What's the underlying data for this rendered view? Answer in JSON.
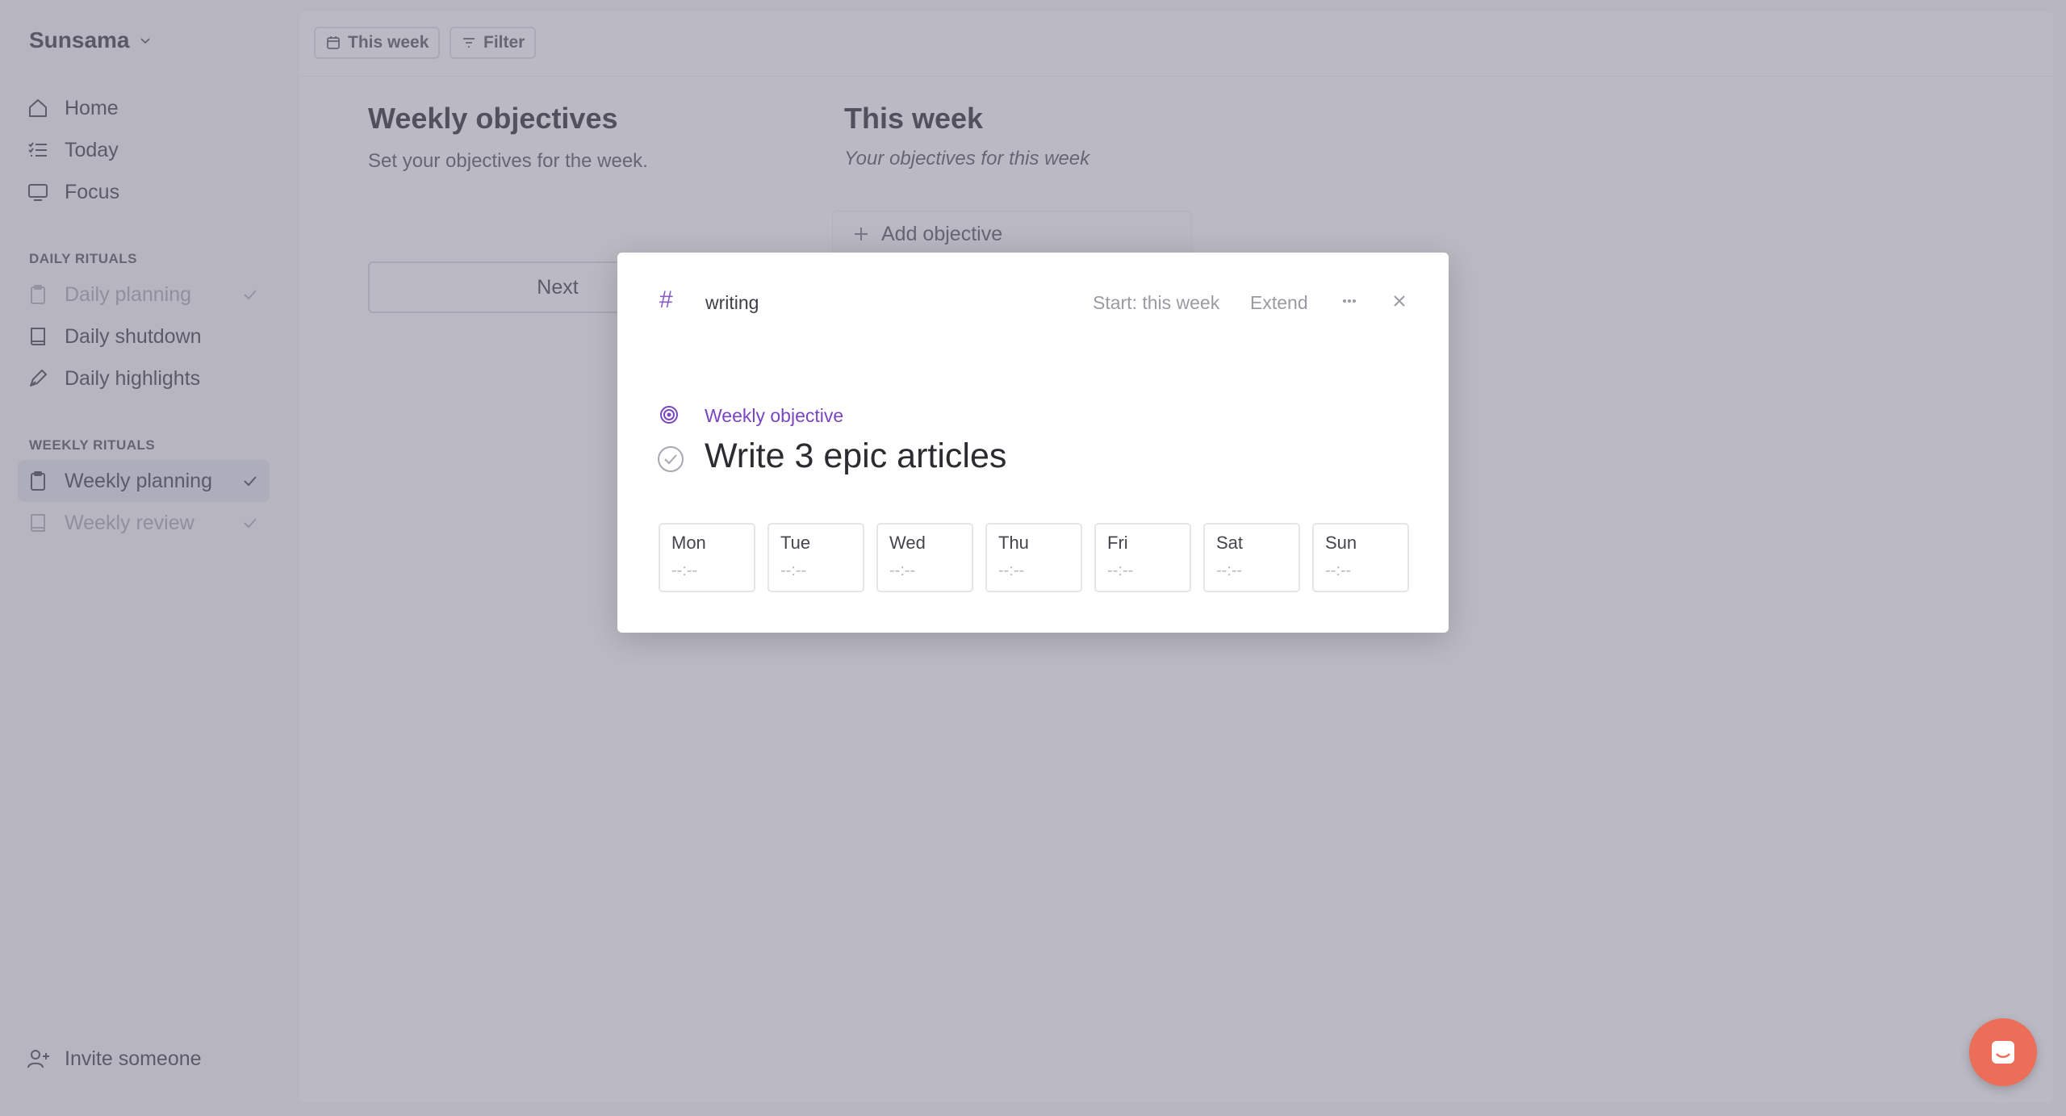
{
  "sidebar": {
    "workspace": "Sunsama",
    "main_nav": [
      {
        "label": "Home",
        "icon": "home-icon"
      },
      {
        "label": "Today",
        "icon": "list-icon"
      },
      {
        "label": "Focus",
        "icon": "focus-icon"
      }
    ],
    "daily_label": "DAILY RITUALS",
    "daily": [
      {
        "label": "Daily planning",
        "icon": "clipboard-icon",
        "done": true
      },
      {
        "label": "Daily shutdown",
        "icon": "book-icon",
        "done": false
      },
      {
        "label": "Daily highlights",
        "icon": "pen-icon",
        "done": false
      }
    ],
    "weekly_label": "WEEKLY RITUALS",
    "weekly": [
      {
        "label": "Weekly planning",
        "icon": "clipboard-icon",
        "done": true,
        "active": true
      },
      {
        "label": "Weekly review",
        "icon": "book-icon",
        "done": true
      }
    ],
    "invite": "Invite someone"
  },
  "toolbar": {
    "week_label": "This week",
    "filter_label": "Filter"
  },
  "left_column": {
    "title": "Weekly objectives",
    "subtitle": "Set your objectives for the week.",
    "next_label": "Next"
  },
  "right_column": {
    "title": "This week",
    "subtitle": "Your objectives for this week",
    "add_label": "Add objective"
  },
  "modal": {
    "channel": "writing",
    "start": "Start: this week",
    "extend": "Extend",
    "type": "Weekly objective",
    "title": "Write 3 epic articles",
    "days": [
      {
        "name": "Mon",
        "value": "--:--"
      },
      {
        "name": "Tue",
        "value": "--:--"
      },
      {
        "name": "Wed",
        "value": "--:--"
      },
      {
        "name": "Thu",
        "value": "--:--"
      },
      {
        "name": "Fri",
        "value": "--:--"
      },
      {
        "name": "Sat",
        "value": "--:--"
      },
      {
        "name": "Sun",
        "value": "--:--"
      }
    ]
  },
  "colors": {
    "accent": "#7a45c0",
    "chat": "#ec6d58"
  }
}
